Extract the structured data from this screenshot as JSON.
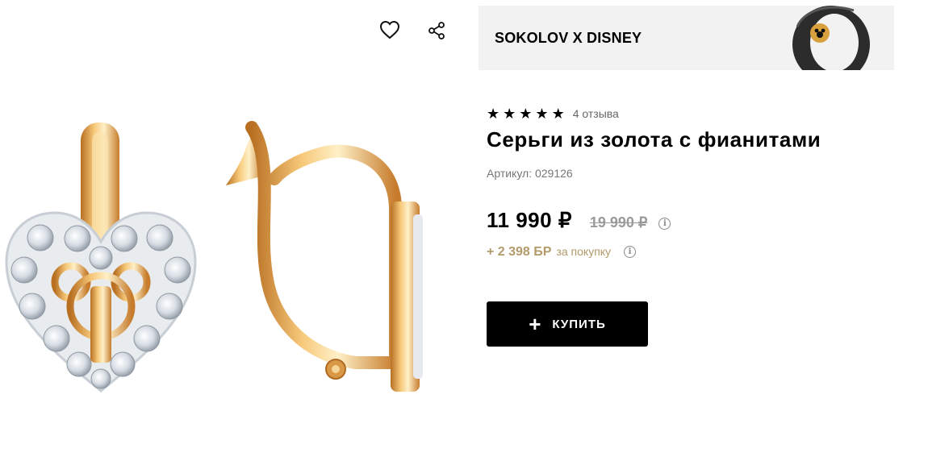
{
  "gallery": {
    "favorite_icon": "heart-icon",
    "share_icon": "share-icon"
  },
  "collab": {
    "title": "SOKOLOV X DISNEY"
  },
  "product": {
    "rating_stars": 5,
    "reviews": "4 отзыва",
    "title": "Серьги из золота с фианитами",
    "sku": "Артикул: 029126"
  },
  "pricing": {
    "price": "11 990 ₽",
    "old_price": "19 990 ₽",
    "bonus": "+ 2 398 БР",
    "bonus_suffix": "за покупку"
  },
  "buy": {
    "label": "КУПИТЬ"
  },
  "colors": {
    "gold": "#e2a24b",
    "bonus": "#b39a6a",
    "button": "#000000"
  }
}
